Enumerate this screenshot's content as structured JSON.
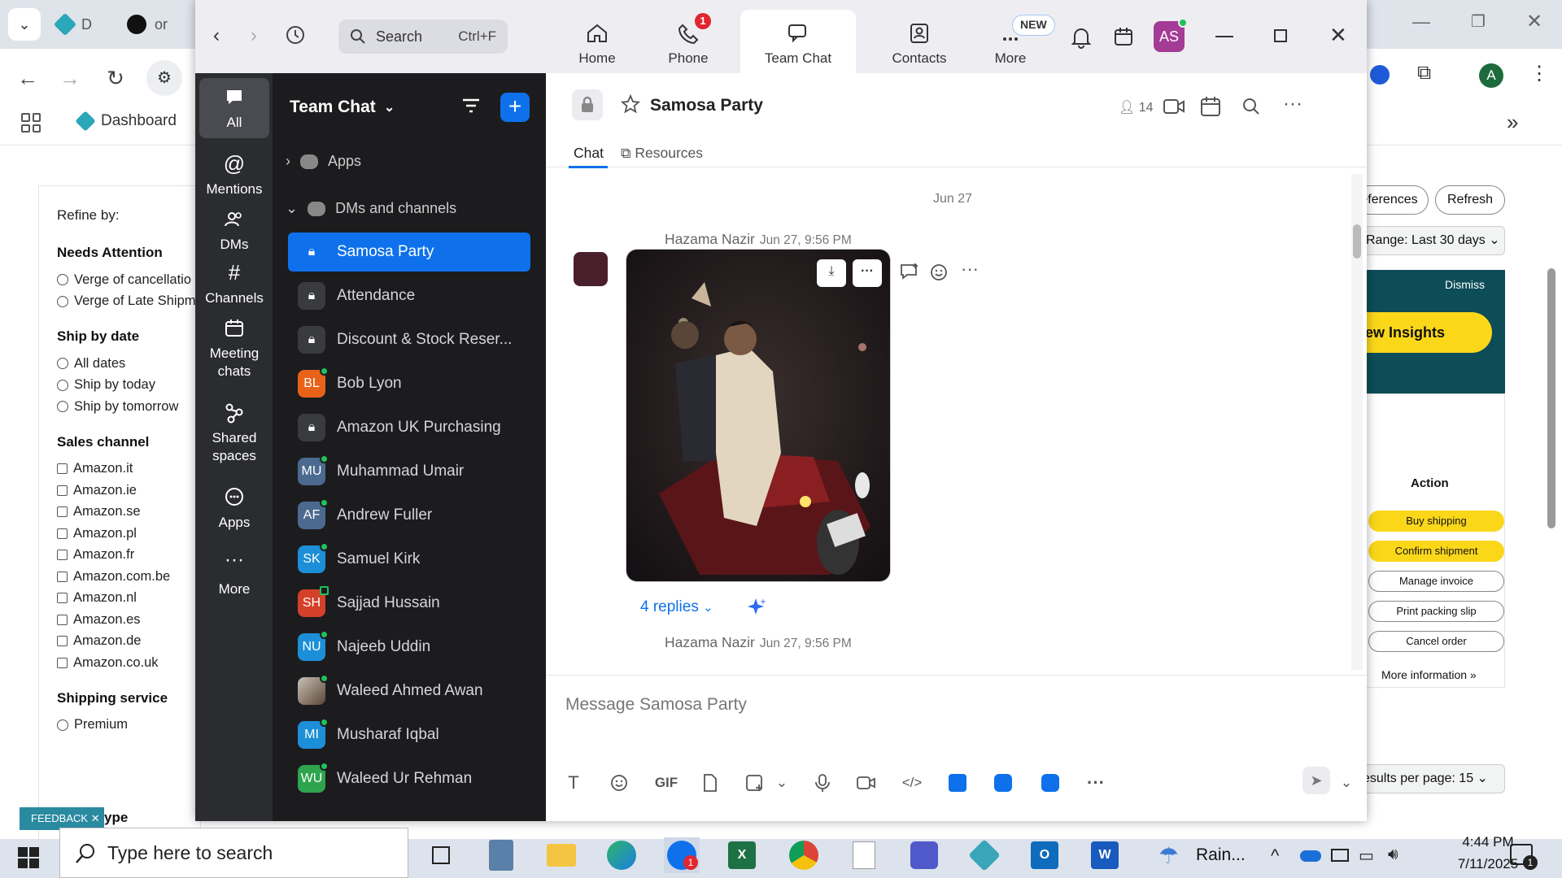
{
  "browser": {
    "tabs": [
      "D",
      "or"
    ],
    "bookmark_label": "Dashboard",
    "profile_initial": "A",
    "refine": {
      "title": "Refine by:",
      "needs_attention": {
        "label": "Needs Attention",
        "options": [
          "Verge of cancellatio",
          "Verge of Late Shipm"
        ]
      },
      "ship_by_date": {
        "label": "Ship by date",
        "options": [
          "All dates",
          "Ship by today",
          "Ship by tomorrow"
        ]
      },
      "sales_channel": {
        "label": "Sales channel",
        "options": [
          "Amazon.it",
          "Amazon.ie",
          "Amazon.se",
          "Amazon.pl",
          "Amazon.fr",
          "Amazon.com.be",
          "Amazon.nl",
          "Amazon.es",
          "Amazon.de",
          "Amazon.co.uk"
        ]
      },
      "shipping_service": {
        "label": "Shipping service",
        "options": [
          "Premium"
        ]
      },
      "type_tail": "ype"
    },
    "feedback_label": "FEEDBACK",
    "right": {
      "preferences_label": "eferences",
      "refresh_label": "Refresh",
      "range_label": "Range: Last 30 days",
      "dismiss_label": "Dismiss",
      "insights_label": "ew Insights",
      "action_header": "Action",
      "actions": [
        "Buy shipping",
        "Confirm shipment",
        "Manage invoice",
        "Print packing slip",
        "Cancel order"
      ],
      "more_info": "More information",
      "results_per_page": "esults per page: 15"
    }
  },
  "zoom": {
    "search_placeholder": "Search",
    "search_shortcut": "Ctrl+F",
    "tabs": [
      {
        "label": "Home",
        "icon": "home-icon"
      },
      {
        "label": "Phone",
        "icon": "phone-icon",
        "badge": "1"
      },
      {
        "label": "Team Chat",
        "icon": "chat-icon"
      },
      {
        "label": "Contacts",
        "icon": "contacts-icon"
      },
      {
        "label": "More",
        "icon": "more-icon",
        "badge": "NEW"
      }
    ],
    "user_initials": "AS",
    "rail": [
      {
        "label": "All"
      },
      {
        "label": "Mentions"
      },
      {
        "label": "DMs"
      },
      {
        "label": "Channels"
      },
      {
        "label": "Meeting chats"
      },
      {
        "label": "Shared spaces"
      },
      {
        "label": "Apps"
      },
      {
        "label": "More"
      }
    ],
    "list_title": "Team Chat",
    "groups": {
      "apps": "Apps",
      "dms": "DMs and channels"
    },
    "channels": [
      {
        "name": "Samosa Party",
        "type": "lock"
      },
      {
        "name": "Attendance",
        "type": "lock"
      },
      {
        "name": "Discount & Stock Reser...",
        "type": "lock"
      },
      {
        "name": "Bob Lyon",
        "initials": "BL",
        "color": "#e8621a"
      },
      {
        "name": "Amazon UK Purchasing",
        "type": "lock"
      },
      {
        "name": "Muhammad Umair",
        "initials": "MU",
        "color": "#4c6a8f"
      },
      {
        "name": "Andrew Fuller",
        "initials": "AF",
        "color": "#4c6a8f"
      },
      {
        "name": "Samuel Kirk",
        "initials": "SK",
        "color": "#1c8fd8"
      },
      {
        "name": "Sajjad Hussain",
        "initials": "SH",
        "color": "#d4402a"
      },
      {
        "name": "Najeeb Uddin",
        "initials": "NU",
        "color": "#1c8fd8"
      },
      {
        "name": "Waleed Ahmed Awan",
        "initials": "",
        "color": "#6b5b4b"
      },
      {
        "name": "Musharaf Iqbal",
        "initials": "MI",
        "color": "#1c8fd8"
      },
      {
        "name": "Waleed Ur Rehman",
        "initials": "WU",
        "color": "#2ea44f"
      }
    ],
    "chat": {
      "channel_name": "Samosa Party",
      "member_count": "14",
      "subtabs": [
        "Chat",
        "Resources"
      ],
      "date_separator": "Jun 27",
      "messages": [
        {
          "author": "Hazama Nazir",
          "time": "Jun 27, 9:56 PM",
          "replies": "4 replies"
        },
        {
          "author": "Hazama Nazir",
          "time": "Jun 27, 9:56 PM"
        }
      ],
      "composer_placeholder": "Message Samosa Party",
      "gif_label": "GIF"
    }
  },
  "taskbar": {
    "search_placeholder": "Type here to search",
    "weather": "Rain...",
    "time": "4:44 PM",
    "date": "7/11/2025",
    "notif_count": "1",
    "zoom_badge": "1"
  },
  "colors": {
    "zoom_blue": "#0e71eb",
    "rail_bg": "#2b2c30",
    "list_bg": "#1c1c1f",
    "amazon_yellow": "#fbd71a",
    "teal": "#0d4d57"
  }
}
